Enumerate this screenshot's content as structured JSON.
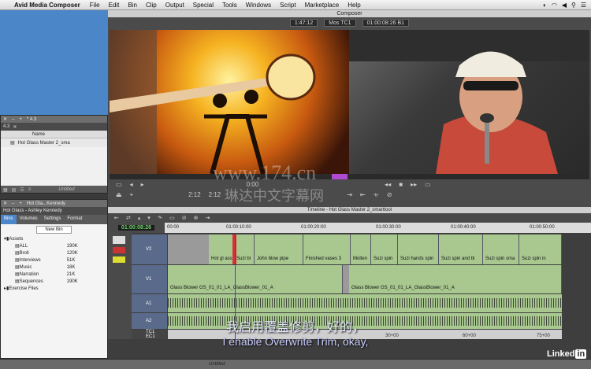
{
  "menubar": {
    "app": "Avid Media Composer",
    "items": [
      "File",
      "Edit",
      "Bin",
      "Clip",
      "Output",
      "Special",
      "Tools",
      "Windows",
      "Script",
      "Marketplace",
      "Help"
    ]
  },
  "bin1": {
    "title": "* 4.3",
    "tab": "4.3",
    "column": "Name",
    "row": "Hot Glass Master 2_sma",
    "footer": "Untitled"
  },
  "bin2": {
    "tab_title": "Hot Gla...Kennedy",
    "header": "Hot Glass - Ashley Kennedy",
    "tabs": [
      "Bins",
      "Volumes",
      "Settings",
      "Format"
    ],
    "new_bin": "New Bin",
    "folders": [
      {
        "name": "Assets",
        "size": "",
        "expanded": true
      },
      {
        "name": "ALL",
        "size": "190K"
      },
      {
        "name": "Broll",
        "size": "120K"
      },
      {
        "name": "Interviews",
        "size": "51K"
      },
      {
        "name": "Music",
        "size": "18K"
      },
      {
        "name": "Narration",
        "size": "21K"
      },
      {
        "name": "Sequences",
        "size": "190K"
      },
      {
        "name": "Exercise Files",
        "size": "",
        "expanded": false
      }
    ]
  },
  "composer": {
    "title": "Composer",
    "left_tc": "1:47:12",
    "mos_tc": "Mos TC1",
    "right_tc": "01:00:08:26 B1",
    "center_time": "0:00",
    "left_ctrl_tc": "2:12",
    "right_ctrl_tc": "2:12"
  },
  "timeline": {
    "title": "Timeline - Hot Glass Master 2_smarttool",
    "timecode": "01:00:08:26",
    "ruler": [
      "00:00",
      "01:00:10:00",
      "01:00:20:00",
      "01:00:30:00",
      "01:00:40:00",
      "01:00:50:00"
    ],
    "tracks": [
      "V2",
      "V1",
      "A1",
      "A2",
      "TC1",
      "EC1"
    ],
    "v2_clips": [
      "Hot gl ass",
      "Suzi bl",
      "John blow pipe",
      "Finished vases 3",
      "Molten",
      "Suzi spin",
      "Suzi hands spin",
      "Suzi spin and bl",
      "Suzi spin sma",
      "Suzi spin in"
    ],
    "v1_clip": "Glass Blower GS_01_01_LA_GlassBlower_01_A",
    "v1_clip2": "Glass Blower GS_01_01_LA_GlassBlower_01_A",
    "ec_ruler": [
      "30+00",
      "60+00",
      "75+00"
    ],
    "footer": "Untitled"
  },
  "subtitle": {
    "zh": "我启用覆盖修剪，好的，",
    "en": "I enable Overwrite Trim, okay,"
  },
  "watermark": "www.174.cn",
  "watermark2": "琳达中文字幕网",
  "brand": "Linked",
  "brand_in": "in"
}
